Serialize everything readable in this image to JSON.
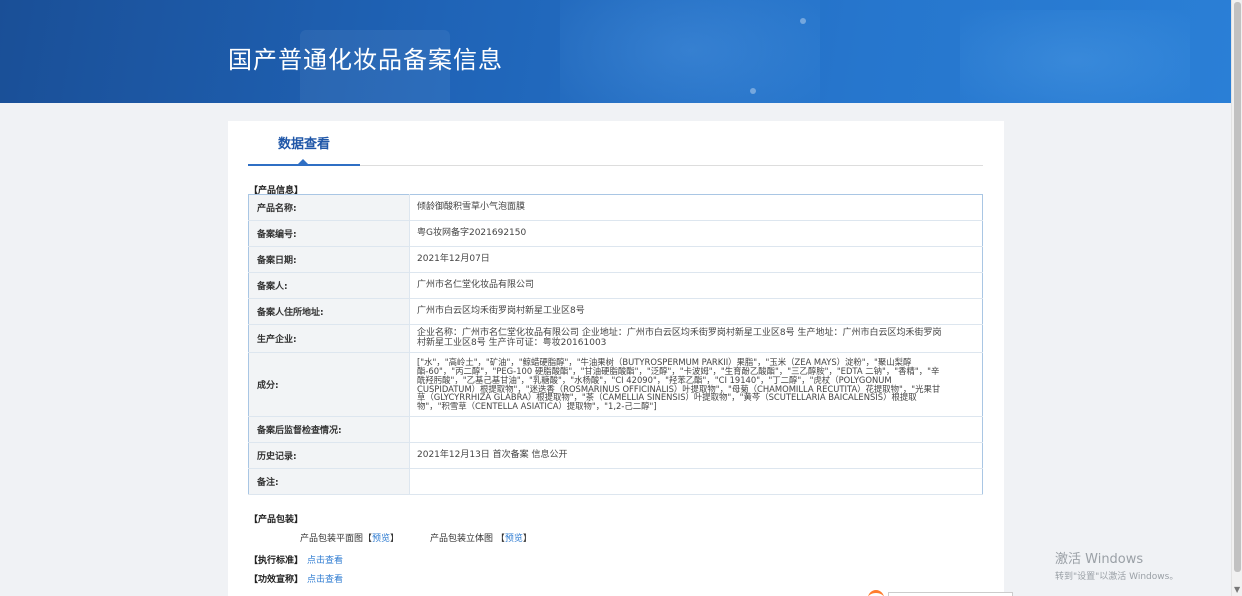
{
  "header": {
    "title": "国产普通化妆品备案信息"
  },
  "tabs": [
    {
      "label": "数据查看"
    }
  ],
  "product_info": {
    "section_title": "【产品信息】",
    "rows": [
      {
        "key": "产品名称:",
        "value": "倾龄御酸积雪草小气泡面膜"
      },
      {
        "key": "备案编号:",
        "value": "粤G妆网备字2021692150"
      },
      {
        "key": "备案日期:",
        "value": "2021年12月07日"
      },
      {
        "key": "备案人:",
        "value": "广州市名仁堂化妆品有限公司"
      },
      {
        "key": "备案人住所地址:",
        "value": "广州市白云区均禾街罗岗村新星工业区8号"
      },
      {
        "key": "生产企业:",
        "value": "企业名称：广州市名仁堂化妆品有限公司 企业地址：广州市白云区均禾街罗岗村新星工业区8号 生产地址：广州市白云区均禾街罗岗村新星工业区8号 生产许可证：粤妆20161003"
      },
      {
        "key": "成分:",
        "value": "[\"水\"，\"高岭土\"，\"矿油\"，\"鲸蜡硬脂醇\"，\"牛油果树（BUTYROSPERMUM PARKII）果脂\"，\"玉米（ZEA MAYS）淀粉\"，\"聚山梨醇酯-60\"，\"丙二醇\"，\"PEG-100 硬脂酸酯\"，\"甘油硬脂酸酯\"，\"泛醇\"，\"卡波姆\"，\"生育酚乙酸酯\"，\"三乙醇胺\"，\"EDTA 二钠\"，\"香精\"，\"辛酰羟肟酸\"，\"乙基己基甘油\"，\"乳糖酸\"，\"水杨酸\"，\"CI 42090\"，\"羟苯乙酯\"，\"CI 19140\"，\"丁二醇\"，\"虎杖（POLYGONUM CUSPIDATUM）根提取物\"，\"迷迭香（ROSMARINUS OFFICINALIS）叶提取物\"，\"母菊（CHAMOMILLA RECUTITA）花提取物\"，\"光果甘草（GLYCYRRHIZA GLABRA）根提取物\"，\"茶（CAMELLIA SINENSIS）叶提取物\"，\"黄芩（SCUTELLARIA BAICALENSIS）根提取物\"，\"积雪草（CENTELLA ASIATICA）提取物\"，\"1,2-己二醇\"]"
      },
      {
        "key": "备案后监督检查情况:",
        "value": ""
      },
      {
        "key": "历史记录:",
        "value": "2021年12月13日 首次备案 信息公开"
      },
      {
        "key": "备注:",
        "value": ""
      }
    ]
  },
  "packaging": {
    "section_title": "【产品包装】",
    "flat_label": "产品包装平面图",
    "solid_label": "产品包装立体图",
    "bracket_open": "【",
    "bracket_close": "】",
    "preview_label": "预览"
  },
  "standard": {
    "label": "【执行标准】",
    "link": "点击查看"
  },
  "efficacy": {
    "label": "【功效宣称】",
    "link": "点击查看"
  },
  "watermark": {
    "line1": "激活 Windows",
    "line2": "转到\"设置\"以激活 Windows。"
  }
}
